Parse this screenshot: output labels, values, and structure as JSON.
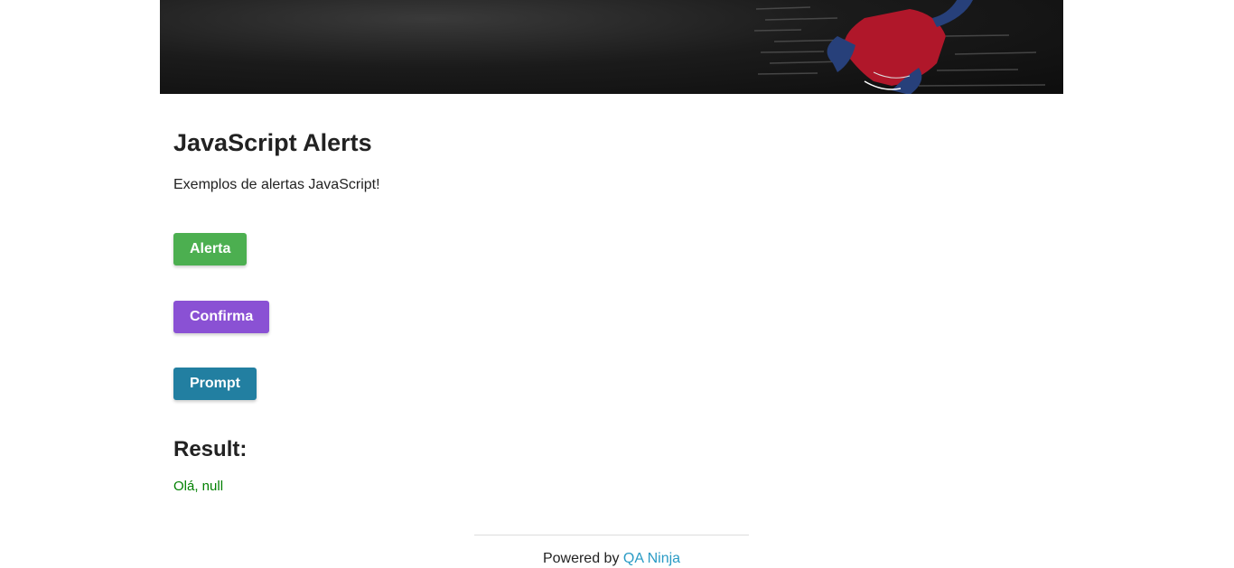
{
  "page": {
    "title": "JavaScript Alerts",
    "subtitle": "Exemplos de alertas JavaScript!"
  },
  "buttons": {
    "alert_label": "Alerta",
    "confirm_label": "Confirma",
    "prompt_label": "Prompt"
  },
  "colors": {
    "alert": "#4caf50",
    "confirm": "#8a51d4",
    "prompt": "#227fa1",
    "result": "#008000",
    "link": "#2a9bc5"
  },
  "result": {
    "heading": "Result:",
    "value": "Olá, null"
  },
  "footer": {
    "prefix": "Powered by",
    "link_text": "QA Ninja"
  },
  "banner": {
    "image": "spider-man-hero-banner"
  }
}
